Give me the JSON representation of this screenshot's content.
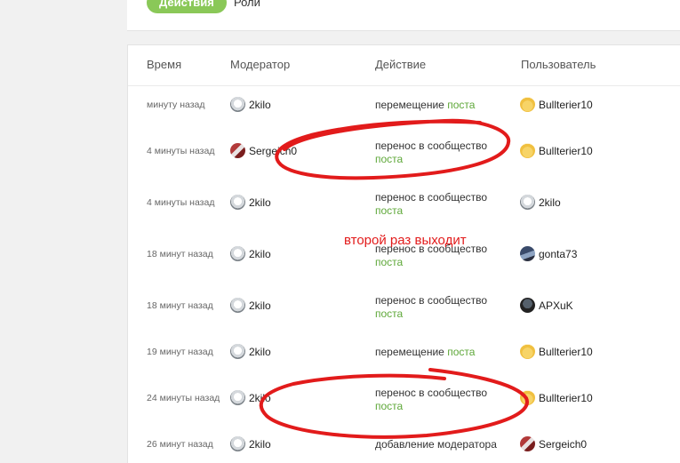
{
  "tabs": [
    {
      "label": "Действия",
      "active": true
    },
    {
      "label": "Роли",
      "active": false
    }
  ],
  "table": {
    "headers": {
      "time": "Время",
      "moderator": "Модератор",
      "action": "Действие",
      "user": "Пользователь"
    },
    "rows": [
      {
        "time": "минуту назад",
        "moderator": "2kilo",
        "moderator_avatar": "dog-avatar",
        "action_text": "перемещение",
        "action_link": "поста",
        "user": "Bullterier10",
        "user_avatar": "bull-avatar"
      },
      {
        "time": "4 минуты назад",
        "moderator": "Sergeich0",
        "moderator_avatar": "sergeich-avatar",
        "action_text": "перенос в сообщество",
        "action_link": "поста",
        "user": "Bullterier10",
        "user_avatar": "bull-avatar"
      },
      {
        "time": "4 минуты назад",
        "moderator": "2kilo",
        "moderator_avatar": "dog-avatar",
        "action_text": "перенос в сообщество",
        "action_link": "поста",
        "user": "2kilo",
        "user_avatar": "dog-avatar"
      },
      {
        "time": "18 минут назад",
        "moderator": "2kilo",
        "moderator_avatar": "dog-avatar",
        "action_text": "перенос в сообщество",
        "action_link": "поста",
        "user": "gonta73",
        "user_avatar": "gonta-avatar"
      },
      {
        "time": "18 минут назад",
        "moderator": "2kilo",
        "moderator_avatar": "dog-avatar",
        "action_text": "перенос в сообщество",
        "action_link": "поста",
        "user": "APXuK",
        "user_avatar": "apxuk-avatar"
      },
      {
        "time": "19 минут назад",
        "moderator": "2kilo",
        "moderator_avatar": "dog-avatar",
        "action_text": "перемещение",
        "action_link": "поста",
        "user": "Bullterier10",
        "user_avatar": "bull-avatar"
      },
      {
        "time": "24 минуты назад",
        "moderator": "2kilo",
        "moderator_avatar": "dog-avatar",
        "action_text": "перенос в сообщество",
        "action_link": "поста",
        "user": "Bullterier10",
        "user_avatar": "bull-avatar"
      },
      {
        "time": "26 минут назад",
        "moderator": "2kilo",
        "moderator_avatar": "dog-avatar",
        "action_text": "добавление модератора",
        "action_link": "",
        "user": "Sergeich0",
        "user_avatar": "sergeich-avatar"
      }
    ]
  },
  "annotation": {
    "text": "второй раз выходит",
    "color": "#e21b1b"
  },
  "colors": {
    "accent": "#8ac858",
    "link": "#5fa83a"
  }
}
